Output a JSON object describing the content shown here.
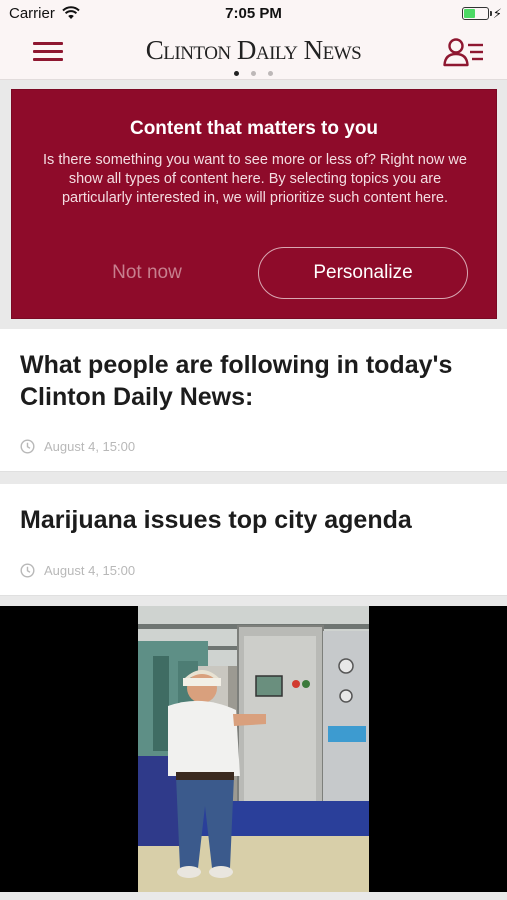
{
  "status_bar": {
    "carrier": "Carrier",
    "time": "7:05 PM",
    "battery_level": 0.5
  },
  "nav": {
    "logo": "Clinton Daily News",
    "page_count": 3,
    "active_page": 1
  },
  "promo": {
    "title": "Content that matters to you",
    "body": "Is there something you want to see more or less of? Right now we show all types of content here. By selecting topics you are particularly interested in, we will prioritize such content here.",
    "not_now_label": "Not now",
    "personalize_label": "Personalize"
  },
  "articles": [
    {
      "title": "What people are following in today's Clinton Daily News:",
      "timestamp": "August 4, 15:00"
    },
    {
      "title": "Marijuana issues top city agenda",
      "timestamp": "August 4, 15:00"
    }
  ],
  "colors": {
    "brand": "#8e0b2a",
    "nav_background": "#fbf5f5",
    "battery": "#4cd964"
  },
  "icons": {
    "menu": "hamburger-menu-icon",
    "profile": "profile-list-icon",
    "clock": "clock-icon",
    "wifi": "wifi-icon",
    "battery": "battery-icon"
  }
}
